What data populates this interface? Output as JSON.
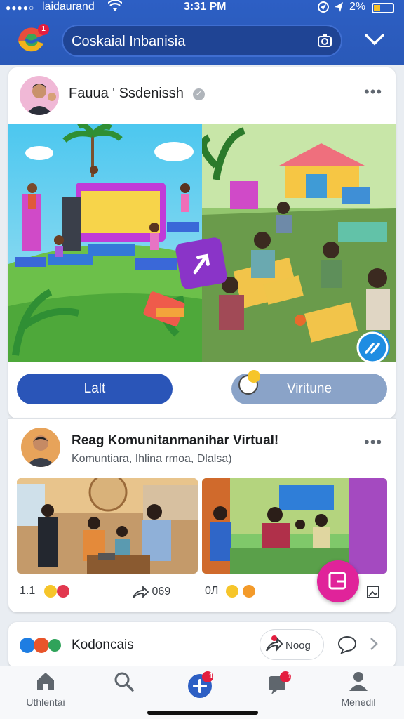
{
  "status_bar": {
    "carrier": "laidaurand",
    "time": "3:31 PM",
    "battery": "2%",
    "signal_dots": "●●●●○"
  },
  "header": {
    "notification_count": "1",
    "search_text": "Coskaial Inbanisia"
  },
  "post1": {
    "author": "Fauua ' Ssdenissh",
    "button_left": "Lalt",
    "button_right": "Viritune"
  },
  "post2": {
    "title": "Reag Komunitanmanihar Virtual!",
    "subtitle": "Komuntiara, Ihlina rmoa, Dlalsa)",
    "reactions_left_count": "1.1",
    "share_count": "069",
    "reactions_right_count": "0Л"
  },
  "post3": {
    "label": "Kodoncais",
    "action_label": "Noog"
  },
  "bottom_nav": {
    "home_label": "Uthlentai",
    "menu_label": "Menedil",
    "create_badge": "1",
    "messages_badge": "1"
  },
  "colors": {
    "header_blue": "#2d5fc4",
    "button_blue": "#2a55b8",
    "fab_pink": "#e0239a",
    "badge_red": "#e41e3f"
  }
}
